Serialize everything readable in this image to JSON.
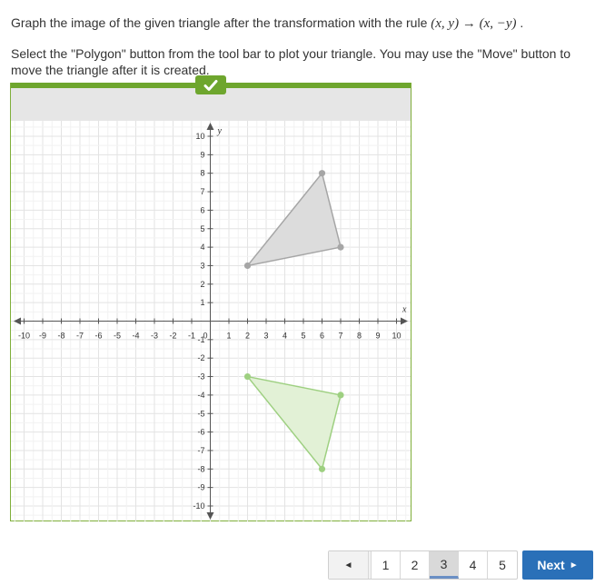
{
  "question": {
    "prefix": "Graph the image of the given triangle after the transformation with the rule ",
    "rule_lhs": "(x,  y)",
    "rule_arrow": "→",
    "rule_rhs": "(x,  −y)",
    "suffix": " ."
  },
  "instructions": "Select the \"Polygon\" button from the tool bar to plot your triangle. You may use the \"Move\" button to move the triangle after it is created.",
  "toolbar": {
    "check_icon": "checkmark-icon"
  },
  "colors": {
    "accent_green": "#6ea62e",
    "frame_border": "#7fae3a",
    "toolbar_bg": "#e6e6e6",
    "given_fill": "#dcdcdc",
    "given_stroke": "#a6a6a6",
    "image_fill": "#e2f1d6",
    "image_stroke": "#9ed081",
    "next_button": "#2a70b8"
  },
  "graph": {
    "x_label": "x",
    "y_label": "y",
    "xlim": [
      -10,
      10
    ],
    "ylim": [
      -10,
      10
    ],
    "grid": true,
    "x_ticks": [
      "-10",
      "-9",
      "-8",
      "-7",
      "-6",
      "-5",
      "-4",
      "-3",
      "-2",
      "-1",
      "1",
      "2",
      "3",
      "4",
      "5",
      "6",
      "7",
      "8",
      "9",
      "10"
    ],
    "y_ticks": [
      "10",
      "9",
      "8",
      "7",
      "6",
      "5",
      "4",
      "3",
      "2",
      "1",
      "-1",
      "-2",
      "-3",
      "-4",
      "-5",
      "-6",
      "-7",
      "-8",
      "-9",
      "-10"
    ],
    "origin_label": "0",
    "given_triangle": [
      [
        2,
        3
      ],
      [
        6,
        8
      ],
      [
        7,
        4
      ]
    ],
    "image_triangle": [
      [
        2,
        -3
      ],
      [
        7,
        -4
      ],
      [
        6,
        -8
      ]
    ]
  },
  "pagination": {
    "prev_label": "◄",
    "pages": [
      "1",
      "2",
      "3",
      "4",
      "5"
    ],
    "current": "3",
    "next_label": "Next",
    "next_arrow": "►"
  }
}
